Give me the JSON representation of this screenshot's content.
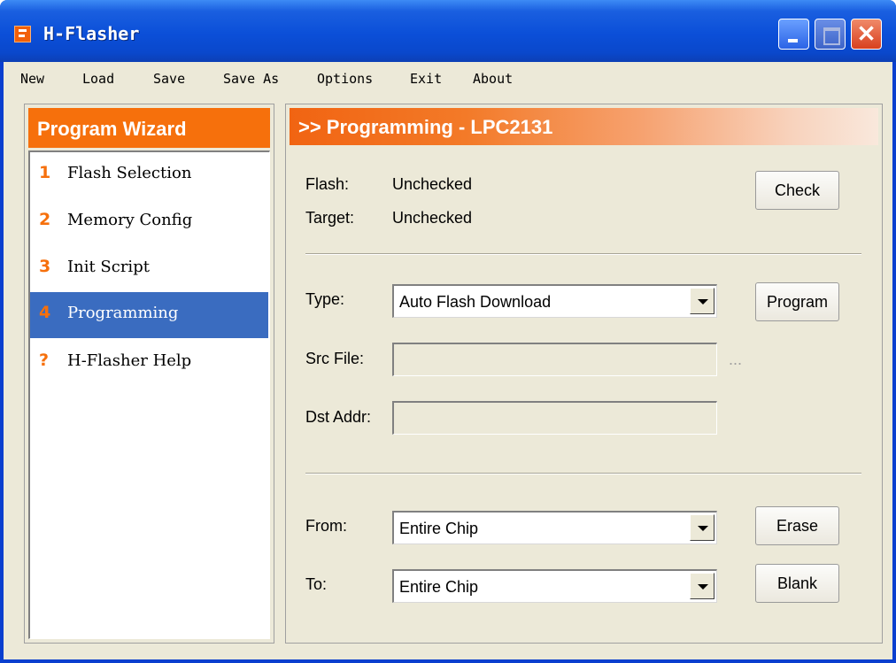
{
  "window": {
    "title": "H-Flasher",
    "controls": {
      "close_glyph": "✕"
    }
  },
  "menu": [
    "New",
    "Load",
    "Save",
    "Save As",
    "Options",
    "Exit",
    "About"
  ],
  "wizard": {
    "title": "Program Wizard",
    "items": [
      {
        "num": "1",
        "label": "Flash Selection"
      },
      {
        "num": "2",
        "label": "Memory Config"
      },
      {
        "num": "3",
        "label": "Init Script"
      },
      {
        "num": "4",
        "label": "Programming"
      },
      {
        "num": "?",
        "label": "H-Flasher Help"
      }
    ]
  },
  "panel": {
    "title": ">> Programming - LPC2131",
    "flash_label": "Flash:",
    "flash_value": "Unchecked",
    "target_label": "Target:",
    "target_value": "Unchecked",
    "check_button": "Check",
    "type_label": "Type:",
    "type_value": "Auto Flash Download",
    "program_button": "Program",
    "src_label": "Src File:",
    "src_value": "",
    "browse": "...",
    "dst_label": "Dst Addr:",
    "dst_value": "",
    "from_label": "From:",
    "from_value": "Entire Chip",
    "erase_button": "Erase",
    "to_label": "To:",
    "to_value": "Entire Chip",
    "blank_button": "Blank"
  }
}
